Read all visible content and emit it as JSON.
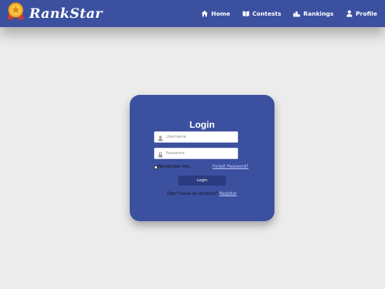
{
  "brand": {
    "name": "RankStar",
    "logo_icon": "medal-icon"
  },
  "nav": {
    "items": [
      {
        "label": "Home",
        "icon": "home-icon"
      },
      {
        "label": "Contests",
        "icon": "book-icon"
      },
      {
        "label": "Rankings",
        "icon": "podium-icon"
      },
      {
        "label": "Profile",
        "icon": "user-icon"
      }
    ]
  },
  "login": {
    "title": "Login",
    "username_placeholder": "Username",
    "password_placeholder": "Password",
    "remember_label": "Remember me...",
    "forgot_label": "Forgot Password?",
    "button_label": "Login",
    "no_account_text": "Don't have an account?",
    "register_label": "Register"
  },
  "colors": {
    "primary": "#3c50a0",
    "button": "#2c3c82",
    "background": "#ececec",
    "link": "#c8d2ff"
  }
}
